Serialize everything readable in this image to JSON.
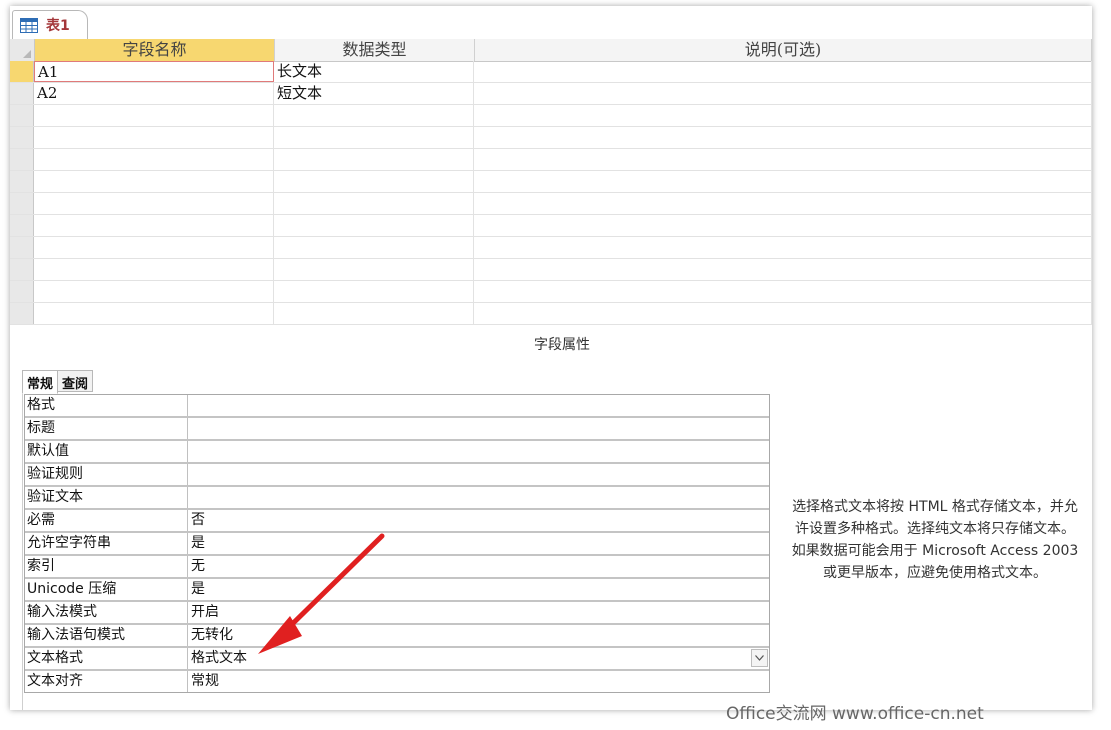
{
  "document_tab": {
    "label": "表1",
    "icon": "table-icon"
  },
  "grid": {
    "columns": [
      "字段名称",
      "数据类型",
      "说明(可选)"
    ],
    "rows": [
      {
        "name": "A1",
        "type": "长文本",
        "desc": ""
      },
      {
        "name": "A2",
        "type": "短文本",
        "desc": ""
      }
    ]
  },
  "properties": {
    "title": "字段属性",
    "tabs": [
      "常规",
      "查阅"
    ],
    "items": [
      {
        "label": "格式",
        "value": ""
      },
      {
        "label": "标题",
        "value": ""
      },
      {
        "label": "默认值",
        "value": ""
      },
      {
        "label": "验证规则",
        "value": ""
      },
      {
        "label": "验证文本",
        "value": ""
      },
      {
        "label": "必需",
        "value": "否"
      },
      {
        "label": "允许空字符串",
        "value": "是"
      },
      {
        "label": "索引",
        "value": "无"
      },
      {
        "label": "Unicode 压缩",
        "value": "是"
      },
      {
        "label": "输入法模式",
        "value": "开启"
      },
      {
        "label": "输入法语句模式",
        "value": "无转化"
      },
      {
        "label": "文本格式",
        "value": "格式文本"
      },
      {
        "label": "文本对齐",
        "value": "常规"
      }
    ],
    "help_lines": [
      "选择格式文本将按 HTML 格式存储文本，并允",
      "许设置多种格式。选择纯文本将只存储文本。",
      "如果数据可能会用于 Microsoft Access 2003",
      "或更早版本，应避免使用格式文本。"
    ]
  },
  "watermark": "Office交流网 www.office-cn.net",
  "colors": {
    "accent_header": "#f7d770",
    "tab_text": "#a4373a",
    "arrow": "#e02020"
  }
}
